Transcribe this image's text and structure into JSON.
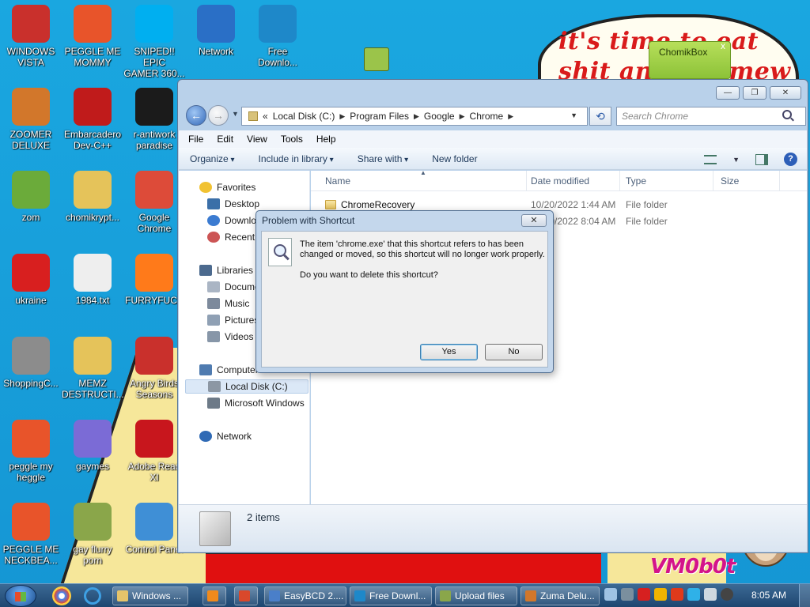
{
  "wallpaper": {
    "note_text": "it's time to eat shit and die mew",
    "watermark": "VM0b0t"
  },
  "desktop_icons": [
    {
      "label": "WINDOWS\nVISTA",
      "icon": "windows-vista-icon",
      "color": "#c9302c"
    },
    {
      "label": "PEGGLE ME\nMOMMY",
      "icon": "peggle-icon",
      "color": "#e8542a"
    },
    {
      "label": "SNIPED!! EPIC\nGAMER 360...",
      "icon": "skype-icon",
      "color": "#00aff0"
    },
    {
      "label": "Network",
      "icon": "network-globe-icon",
      "color": "#2a6fc6"
    },
    {
      "label": "Free\nDownlo...",
      "icon": "free-download-icon",
      "color": "#1e88c9"
    },
    {
      "label": "ZOOMER\nDELUXE",
      "icon": "zuma-deluxe-icon",
      "color": "#d2772b"
    },
    {
      "label": "Embarcadero\nDev-C++",
      "icon": "devcpp-icon",
      "color": "#c01b1b"
    },
    {
      "label": "r-antiwork\nparadise",
      "icon": "r-antiwork-icon",
      "color": "#1b1b1b"
    },
    {
      "label": "zom",
      "icon": "zombie-plant-icon",
      "color": "#6bab3a"
    },
    {
      "label": "chomikrypt...",
      "icon": "chomikbox-installer-icon",
      "color": "#e5c35a"
    },
    {
      "label": "Google\nChrome",
      "icon": "chrome-icon",
      "color": "#dd4b39"
    },
    {
      "label": "ukraine",
      "icon": "radiation-icon",
      "color": "#d81f1f"
    },
    {
      "label": "1984.txt",
      "icon": "text-file-icon",
      "color": "#eeeeee"
    },
    {
      "label": "FURRYFUCK",
      "icon": "firefox-icon",
      "color": "#ff7a1a"
    },
    {
      "label": "ShoppingC...",
      "icon": "flash-icon",
      "color": "#8c8c8c"
    },
    {
      "label": "MEMZ\nDESTRUCTI...",
      "icon": "memz-installer-icon",
      "color": "#e5c35a"
    },
    {
      "label": "Angry Birds\nSeasons",
      "icon": "angry-birds-icon",
      "color": "#c9302c"
    },
    {
      "label": "peggle my\nheggle",
      "icon": "peggle-icon",
      "color": "#e8542a"
    },
    {
      "label": "gaymes",
      "icon": "games-folder-icon",
      "color": "#7b6bd6"
    },
    {
      "label": "Adobe Read\nXI",
      "icon": "adobe-reader-icon",
      "color": "#c8161d"
    },
    {
      "label": "PEGGLE ME\nNECKBEA...",
      "icon": "peggle-icon",
      "color": "#e8542a"
    },
    {
      "label": "gay flurry\nporn",
      "icon": "chomikbox-icon",
      "color": "#8aa64a"
    },
    {
      "label": "Control Panel",
      "icon": "control-panel-icon",
      "color": "#3f8fd6"
    }
  ],
  "chomikbox_widget": {
    "title": "ChomikBox",
    "close": "x"
  },
  "explorer": {
    "window_controls": {
      "minimize": "—",
      "maximize": "❐",
      "close": "✕"
    },
    "breadcrumb": [
      "«",
      "Local Disk (C:)",
      "Program Files",
      "Google",
      "Chrome"
    ],
    "search_placeholder": "Search Chrome",
    "menu": [
      "File",
      "Edit",
      "View",
      "Tools",
      "Help"
    ],
    "commands": {
      "organize": "Organize",
      "include": "Include in library",
      "share": "Share with",
      "new_folder": "New folder"
    },
    "nav": {
      "favorites": "Favorites",
      "desktop": "Desktop",
      "downloads": "Downloads",
      "recent": "Recent Places",
      "libraries": "Libraries",
      "documents": "Documents",
      "music": "Music",
      "pictures": "Pictures",
      "videos": "Videos",
      "computer": "Computer",
      "local_disk": "Local Disk (C:)",
      "ms_windows": "Microsoft Windows",
      "network": "Network"
    },
    "columns": {
      "name": "Name",
      "date": "Date modified",
      "type": "Type",
      "size": "Size"
    },
    "rows": [
      {
        "name": "ChromeRecovery",
        "date": "10/20/2022 1:44 AM",
        "type": "File folder",
        "size": ""
      },
      {
        "name": "",
        "date": "10/20/2022 8:04 AM",
        "type": "File folder",
        "size": ""
      }
    ],
    "status": "2 items"
  },
  "dialog": {
    "title": "Problem with Shortcut",
    "close": "✕",
    "message": "The item 'chrome.exe' that this shortcut refers to has been changed or moved, so this shortcut will no longer work properly.",
    "question": "Do you want to delete this shortcut?",
    "yes": "Yes",
    "no": "No"
  },
  "taskbar": {
    "tasks": [
      {
        "label": "Windows ...",
        "icon": "folder-icon",
        "color": "#e6c46a"
      },
      {
        "label": "",
        "icon": "media-player-icon",
        "color": "#f08a1c"
      },
      {
        "label": "",
        "icon": "paint-icon",
        "color": "#d9482b"
      },
      {
        "label": "EasyBCD 2....",
        "icon": "easybcd-icon",
        "color": "#4a7fc9"
      },
      {
        "label": "Free Downl...",
        "icon": "free-download-icon",
        "color": "#1e88c9"
      },
      {
        "label": "Upload files",
        "icon": "chomikbox-icon",
        "color": "#8aa64a"
      },
      {
        "label": "Zuma Delu...",
        "icon": "zuma-deluxe-icon",
        "color": "#d2772b"
      }
    ],
    "clock": "8:05 AM"
  }
}
